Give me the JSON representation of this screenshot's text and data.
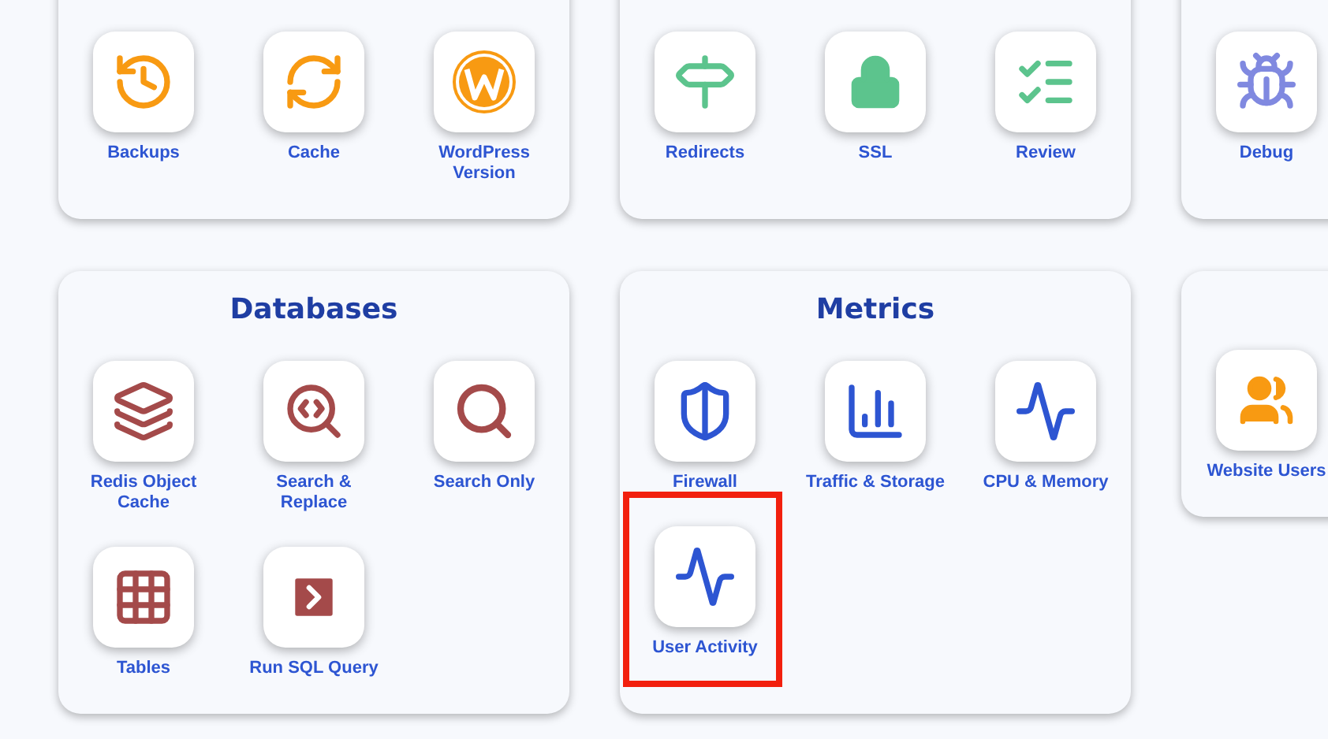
{
  "cards": [
    {
      "items": [
        {
          "kind": "backups",
          "label": "Backups",
          "highlighted": false
        },
        {
          "kind": "cache",
          "label": "Cache",
          "highlighted": false
        },
        {
          "kind": "wordpress",
          "label": "WordPress Version",
          "highlighted": false
        }
      ]
    },
    {
      "items": [
        {
          "kind": "redirects",
          "label": "Redirects",
          "highlighted": false
        },
        {
          "kind": "ssl",
          "label": "SSL",
          "highlighted": false
        },
        {
          "kind": "review",
          "label": "Review",
          "highlighted": false
        }
      ]
    },
    {
      "items": [
        {
          "kind": "debug",
          "label": "Debug",
          "highlighted": false
        }
      ]
    },
    {
      "title": "Databases",
      "items": [
        {
          "kind": "redis",
          "label": "Redis Object Cache",
          "highlighted": false
        },
        {
          "kind": "search-replace",
          "label": "Search & Replace",
          "highlighted": false
        },
        {
          "kind": "search",
          "label": "Search Only",
          "highlighted": false
        },
        {
          "kind": "tables",
          "label": "Tables",
          "highlighted": false
        },
        {
          "kind": "sql",
          "label": "Run SQL Query",
          "highlighted": false
        }
      ]
    },
    {
      "title": "Metrics",
      "items": [
        {
          "kind": "firewall",
          "label": "Firewall",
          "highlighted": false
        },
        {
          "kind": "traffic",
          "label": "Traffic & Storage",
          "highlighted": false
        },
        {
          "kind": "cpu",
          "label": "CPU & Memory",
          "highlighted": false
        },
        {
          "kind": "activity",
          "label": "User Activity",
          "highlighted": true
        }
      ]
    },
    {
      "items": [
        {
          "kind": "users",
          "label": "Website Users",
          "highlighted": false
        }
      ]
    }
  ]
}
